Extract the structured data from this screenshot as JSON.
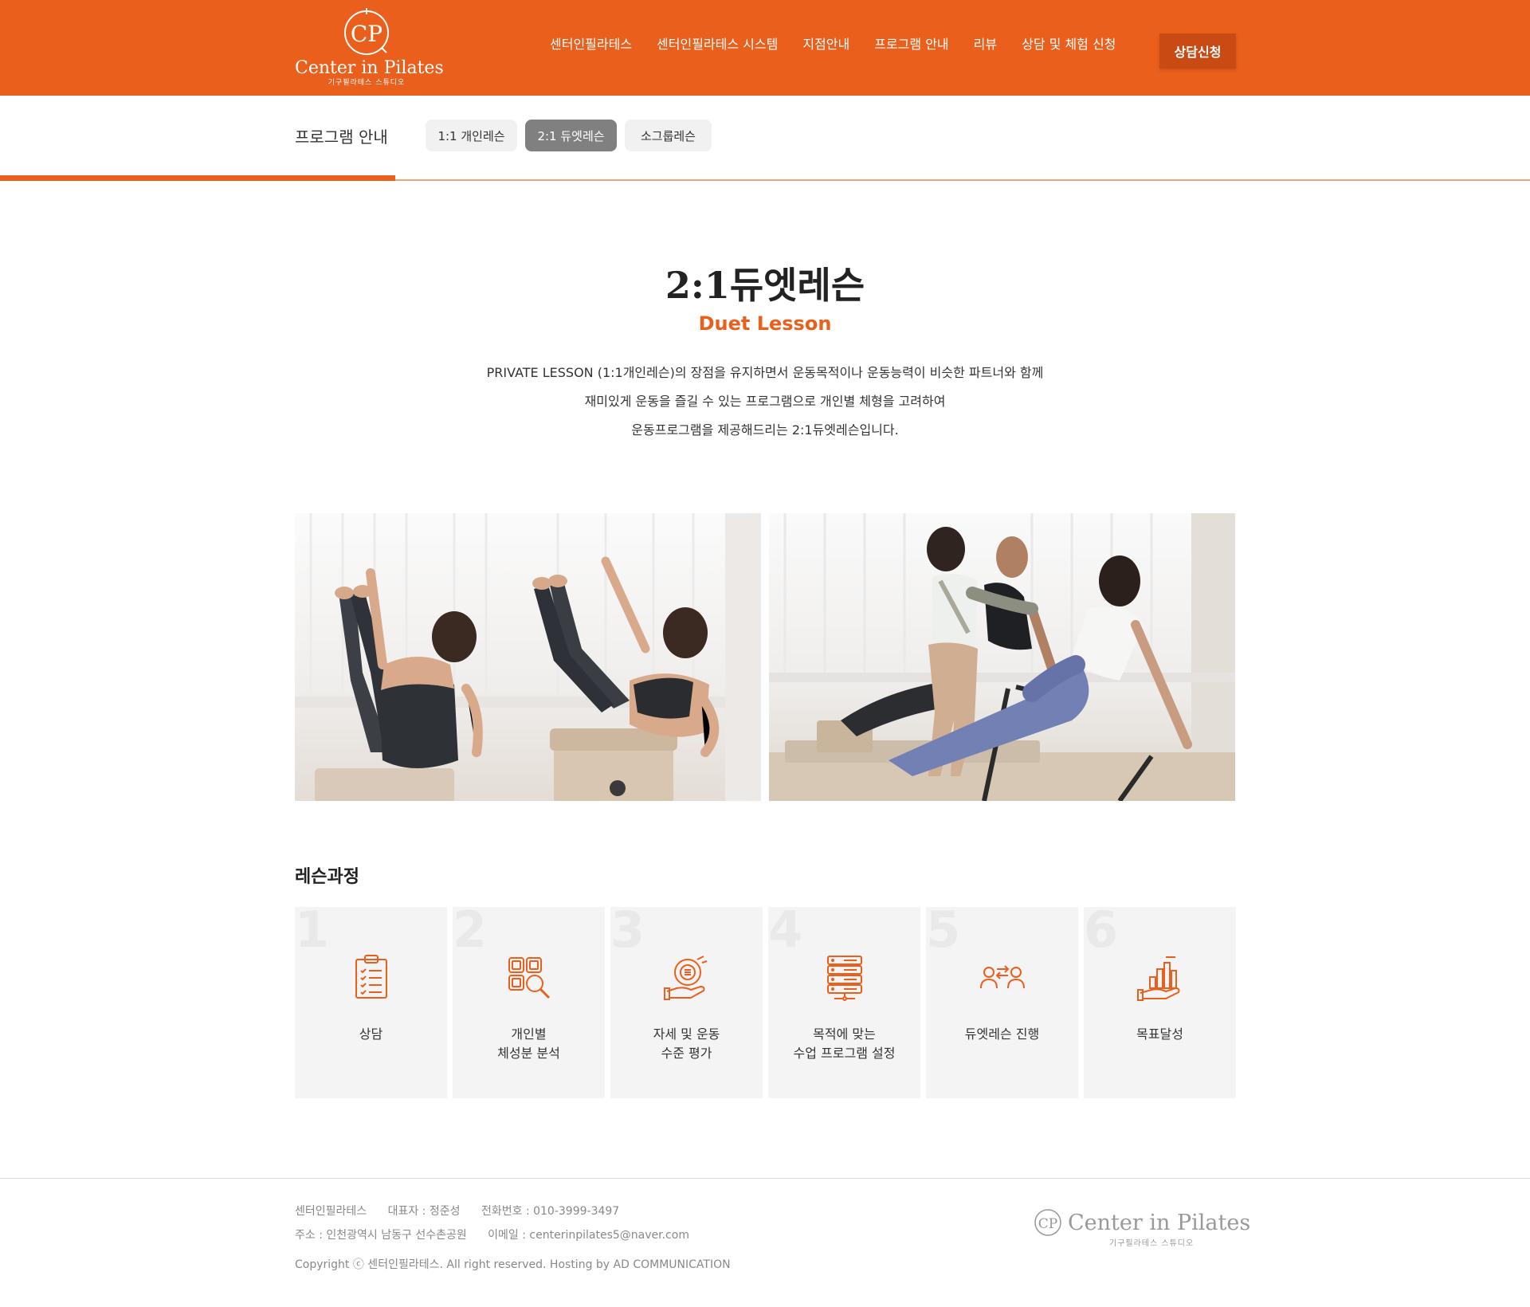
{
  "header": {
    "logo": {
      "monogram": "CP",
      "name": "Center in Pilates",
      "subtitle": "기구필라테스 스튜디오"
    },
    "nav": [
      "센터인필라테스",
      "센터인필라테스 시스템",
      "지점안내",
      "프로그램 안내",
      "리뷰",
      "상담 및 체험 신청"
    ],
    "cta": "상담신청",
    "brand_color": "#ea5f1c"
  },
  "subnav": {
    "title": "프로그램 안내",
    "tabs": [
      {
        "label": "1:1 개인레슨",
        "active": false
      },
      {
        "label": "2:1 듀엣레슨",
        "active": true
      },
      {
        "label": "소그룹레슨",
        "active": false
      }
    ]
  },
  "intro": {
    "title": "2:1듀엣레슨",
    "subtitle": "Duet Lesson",
    "lines": [
      "PRIVATE LESSON (1:1개인레슨)의 장점을 유지하면서 운동목적이나 운동능력이 비슷한 파트너와 함께",
      "재미있게 운동을 즐길 수 있는 프로그램으로 개인별 체형을 고려하여",
      "운동프로그램을 제공해드리는 2:1듀엣레슨입니다."
    ]
  },
  "process": {
    "title": "레슨과정",
    "steps": [
      {
        "num": "1",
        "label": "상담",
        "icon": "clipboard-icon"
      },
      {
        "num": "2",
        "label": "개인별\n체성분 분석",
        "icon": "analysis-icon"
      },
      {
        "num": "3",
        "label": "자세 및 운동\n수준 평가",
        "icon": "evaluation-icon"
      },
      {
        "num": "4",
        "label": "목적에 맞는\n수업 프로그램 설정",
        "icon": "server-icon"
      },
      {
        "num": "5",
        "label": "듀엣레슨 진행",
        "icon": "people-exchange-icon"
      },
      {
        "num": "6",
        "label": "목표달성",
        "icon": "growth-chart-icon"
      }
    ]
  },
  "footer": {
    "company": "센터인필라테스",
    "ceo": "대표자 : 정준성",
    "phone": "전화번호 : 010-3999-3497",
    "address": "주소 : 인천광역시 남동구 선수촌공원",
    "email": "이메일 : centerinpilates5@naver.com",
    "copyright": "Copyright ⓒ 센터인필라테스. All right reserved. Hosting by AD COMMUNICATION",
    "logo_name": "Center in Pilates",
    "logo_sub": "기구필라테스 스튜디오"
  }
}
